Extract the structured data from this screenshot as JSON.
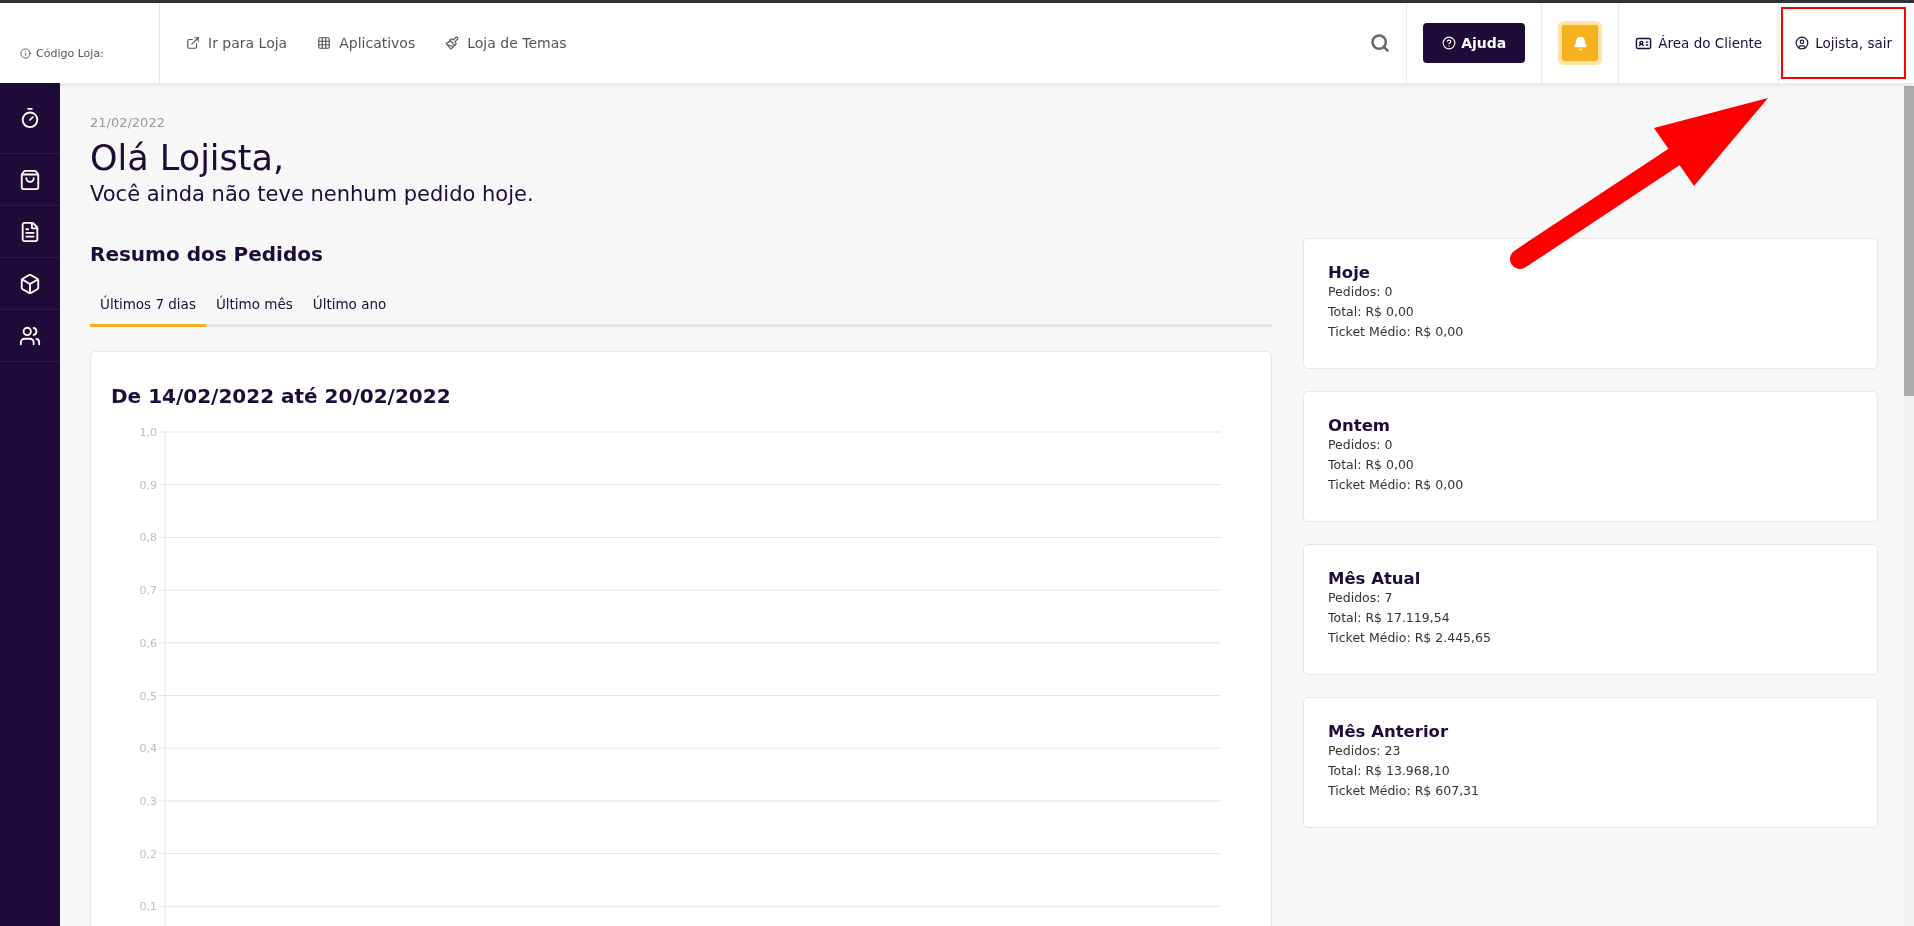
{
  "topbar": {
    "store_code_label": "Código Loja:",
    "links": [
      {
        "kind": "external",
        "label": "Ir para Loja"
      },
      {
        "kind": "apps",
        "label": "Aplicativos"
      },
      {
        "kind": "themes",
        "label": "Loja de Temas"
      }
    ],
    "help_button": "Ajuda",
    "client_area": "Área do Cliente",
    "logout": {
      "label": "Lojista, sair",
      "highlighted": true
    }
  },
  "greeting": {
    "date": "21/02/2022",
    "title": "Olá Lojista,",
    "subtitle": "Você ainda não teve nenhum pedido hoje."
  },
  "summary": {
    "title": "Resumo dos Pedidos",
    "tabs": [
      {
        "label": "Últimos 7 dias",
        "selected": true
      },
      {
        "label": "Último mês",
        "selected": false
      },
      {
        "label": "Último ano",
        "selected": false
      }
    ],
    "chart": {
      "title": "De 14/02/2022 até 20/02/2022",
      "y_axis_labels": [
        "1,0",
        "0,9",
        "0,8",
        "0,7",
        "0,6",
        "0,5",
        "0,4",
        "0,3",
        "0,2",
        "0,1"
      ]
    }
  },
  "stat_cards": [
    {
      "title": "Hoje",
      "lines": [
        "Pedidos: 0",
        "Total: R$ 0,00",
        "Ticket Médio: R$ 0,00"
      ]
    },
    {
      "title": "Ontem",
      "lines": [
        "Pedidos: 0",
        "Total: R$ 0,00",
        "Ticket Médio: R$ 0,00"
      ]
    },
    {
      "title": "Mês Atual",
      "lines": [
        "Pedidos: 7",
        "Total: R$ 17.119,54",
        "Ticket Médio: R$ 2.445,65"
      ]
    },
    {
      "title": "Mês Anterior",
      "lines": [
        "Pedidos: 23",
        "Total: R$ 13.968,10",
        "Ticket Médio: R$ 607,31"
      ]
    }
  ],
  "annotations": [
    {
      "kind": "arrow"
    }
  ]
}
